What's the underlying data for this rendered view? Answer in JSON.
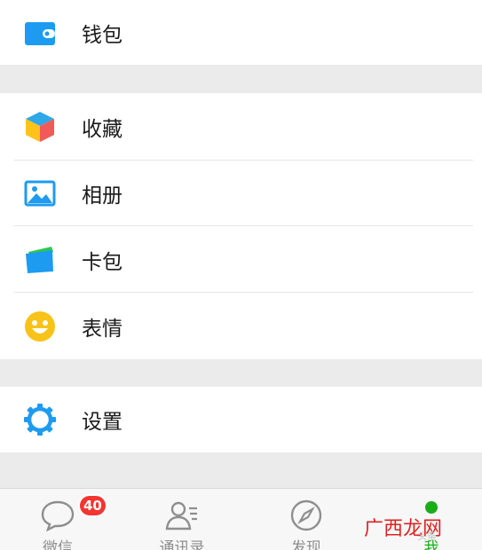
{
  "menu": {
    "wallet": {
      "label": "钱包",
      "icon": "wallet-icon"
    },
    "items": [
      {
        "label": "收藏",
        "icon": "favorites-cube-icon"
      },
      {
        "label": "相册",
        "icon": "album-image-icon"
      },
      {
        "label": "卡包",
        "icon": "card-wallet-icon"
      },
      {
        "label": "表情",
        "icon": "smiley-icon"
      }
    ],
    "settings": {
      "label": "设置",
      "icon": "gear-icon"
    }
  },
  "tabbar": {
    "tabs": [
      {
        "label": "微信",
        "icon": "chat-bubble-icon",
        "badge": "40",
        "active": false
      },
      {
        "label": "通讯录",
        "icon": "contacts-icon",
        "active": false
      },
      {
        "label": "发现",
        "icon": "compass-icon",
        "active": false
      },
      {
        "label": "我",
        "icon": "me-icon",
        "active": true
      }
    ]
  },
  "watermark": {
    "text": "广西龙网",
    "sub": "头条"
  },
  "colors": {
    "accent_green": "#1aad19",
    "badge_red": "#f43530",
    "wallet_blue": "#1d9bf0",
    "smiley_yellow": "#f7c318",
    "settings_blue": "#1d9bf0"
  }
}
